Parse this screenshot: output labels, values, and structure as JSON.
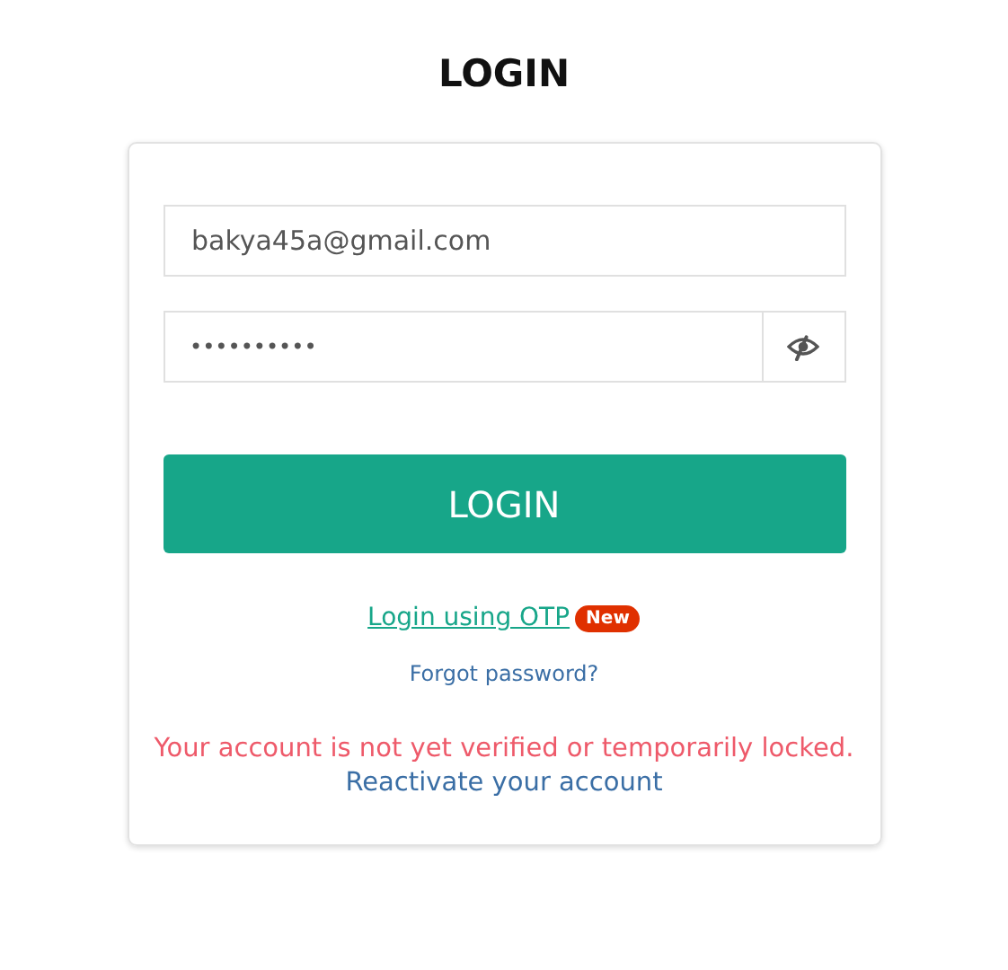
{
  "title": "LOGIN",
  "email": {
    "value": "bakya45a@gmail.com"
  },
  "password": {
    "value": "••••••••••",
    "visible": false
  },
  "login_button": "LOGIN",
  "otp_link": {
    "label": "Login using OTP",
    "badge": "New"
  },
  "forgot_link": "Forgot password?",
  "error": {
    "message": "Your account is not yet verified or temporarily locked.",
    "link": "Reactivate your account"
  }
}
